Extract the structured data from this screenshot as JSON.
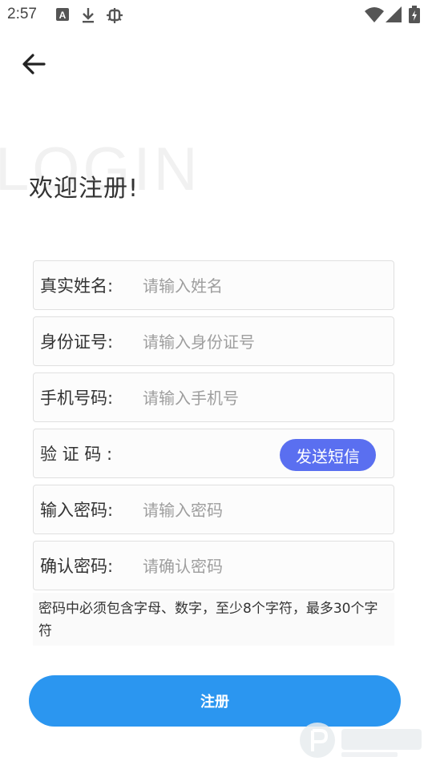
{
  "status_bar": {
    "time": "2:57",
    "left_icons": [
      "a-box-icon",
      "download-icon",
      "bug-icon"
    ],
    "right_icons": [
      "wifi-icon",
      "signal-icon",
      "battery-icon"
    ]
  },
  "page": {
    "watermark_text": "LOGIN",
    "welcome_title": "欢迎注册!"
  },
  "form": {
    "fields": [
      {
        "label": "真实姓名:",
        "placeholder": "请输入姓名"
      },
      {
        "label": "身份证号:",
        "placeholder": "请输入身份证号"
      },
      {
        "label": "手机号码:",
        "placeholder": "请输入手机号"
      },
      {
        "label": "验 证 码 :",
        "placeholder": ""
      },
      {
        "label": "输入密码:",
        "placeholder": "请输入密码"
      },
      {
        "label": "确认密码:",
        "placeholder": "请确认密码"
      }
    ],
    "sms_button_label": "发送短信",
    "password_hint": "密码中必须包含字母、数字，至少8个字符，最多30个字符",
    "submit_label": "注册"
  },
  "colors": {
    "sms_button": "#5a6ff0",
    "submit_button": "#2b96f0"
  }
}
